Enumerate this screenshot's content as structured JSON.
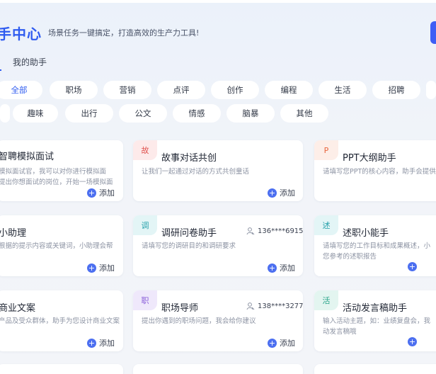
{
  "header": {
    "title": "手中心",
    "subtitle": "场景任务一键搞定，打造高效的生产力工具!"
  },
  "tabs": {
    "my_assistant": "我的助手"
  },
  "categories_row1": [
    "全部",
    "职场",
    "营销",
    "点评",
    "创作",
    "编程",
    "生活",
    "招聘"
  ],
  "categories_row2": [
    "趣味",
    "出行",
    "公文",
    "情感",
    "脑暴",
    "其他"
  ],
  "add_label": "添加",
  "colors": {
    "accent": "#2f5cf0",
    "add_button": "#4c6ff0"
  },
  "cards": {
    "c1": {
      "title": "智聘模拟面试",
      "desc1": "模拟面试官，我可以对你进行模拟面",
      "desc2": "提出你想面试的岗位，开始一场模拟面"
    },
    "c2": {
      "badge": "故",
      "title": "故事对话共创",
      "desc1": "让我们一起通过对话的方式共创童话"
    },
    "c3": {
      "badge": "P",
      "title": "PPT大纲助手",
      "desc1": "请填写您PPT的核心内容，助手会提供"
    },
    "c4": {
      "title": "小助理",
      "desc1": "根据的提示内容或关键词，小助理会帮"
    },
    "c5": {
      "badge": "调",
      "title": "调研问卷助手",
      "users": "136****6915",
      "desc1": "请填写您的调研目的和调研要求"
    },
    "c6": {
      "badge": "述",
      "title": "述职小能手",
      "desc1": "请填写您的工作目标和成果概述，小",
      "desc2": "您参考的述职报告"
    },
    "c7": {
      "title": "商业文案",
      "desc1": "产品及受众群体，助手为您设计商业文案"
    },
    "c8": {
      "badge": "职",
      "title": "职场导师",
      "users": "138****3277",
      "desc1": "提出你遇到的职场问题，我会给你建议"
    },
    "c9": {
      "badge": "活",
      "title": "活动发言稿助手",
      "desc1": "输入活动主题，如：业绩复盘会，我",
      "desc2": "动发言稿哦"
    }
  }
}
